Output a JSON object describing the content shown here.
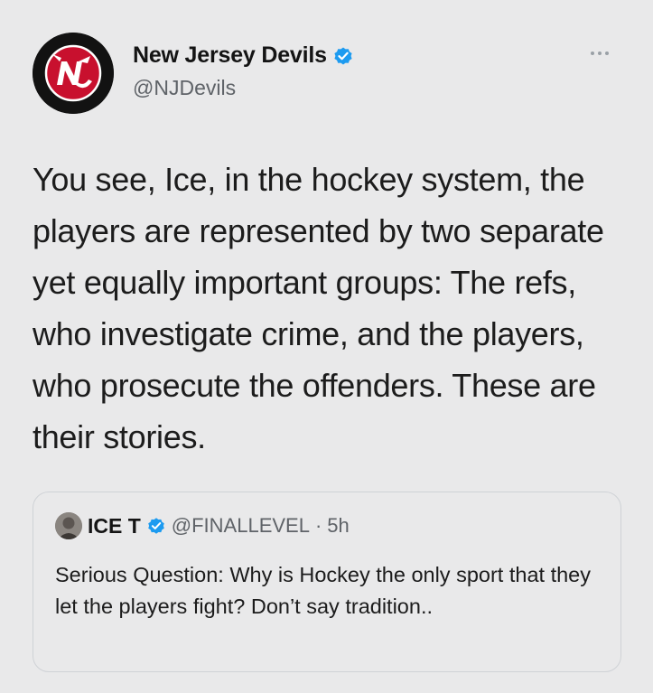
{
  "tweet": {
    "author": {
      "display_name": "New Jersey Devils",
      "handle": "@NJDevils",
      "verified": true,
      "avatar_icon": "nj-devils-logo-icon"
    },
    "more_icon": "more-options-icon",
    "text": "You see, Ice, in the hockey system, the players are represented by two separate yet equally important groups: The refs, who investigate crime, and the players, who prosecute the offenders. These are their stories."
  },
  "quoted_tweet": {
    "author": {
      "display_name": "ICE T",
      "handle": "@FINALLEVEL",
      "verified": true,
      "separator": "·",
      "time": "5h"
    },
    "text": "Serious Question: Why is Hockey the only sport that they let the players fight? Don’t say tradition.."
  },
  "colors": {
    "background": "#e9e9ea",
    "verified": "#1d9bf0",
    "devils_red": "#c8102e"
  }
}
